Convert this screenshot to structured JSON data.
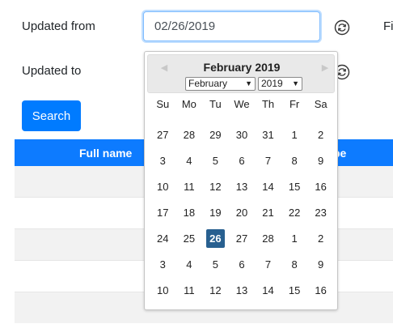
{
  "filters": {
    "updated_from_label": "Updated from",
    "updated_to_label": "Updated to",
    "right_label": "Fi",
    "updated_from_value": "02/26/2019"
  },
  "search_button_label": "Search",
  "table": {
    "columns": [
      "Full name",
      "pe"
    ]
  },
  "datepicker": {
    "title": "February 2019",
    "month": "February",
    "year": "2019",
    "prev_glyph": "◀",
    "next_glyph": "▶",
    "caret": "▼",
    "weekdays": [
      "Su",
      "Mo",
      "Tu",
      "We",
      "Th",
      "Fr",
      "Sa"
    ],
    "weeks": [
      [
        "27",
        "28",
        "29",
        "30",
        "31",
        "1",
        "2"
      ],
      [
        "3",
        "4",
        "5",
        "6",
        "7",
        "8",
        "9"
      ],
      [
        "10",
        "11",
        "12",
        "13",
        "14",
        "15",
        "16"
      ],
      [
        "17",
        "18",
        "19",
        "20",
        "21",
        "22",
        "23"
      ],
      [
        "24",
        "25",
        "26",
        "27",
        "28",
        "1",
        "2"
      ],
      [
        "3",
        "4",
        "5",
        "6",
        "7",
        "8",
        "9"
      ],
      [
        "10",
        "11",
        "12",
        "13",
        "14",
        "15",
        "16"
      ]
    ],
    "selected": "26",
    "accent_color": "#286090"
  },
  "colors": {
    "primary": "#007bff",
    "header_bg": "#0d7bff"
  }
}
